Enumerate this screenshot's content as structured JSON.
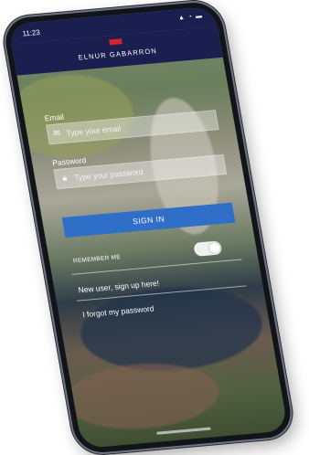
{
  "status_bar": {
    "time": "11:23",
    "icons": "▲ ◔ ▬"
  },
  "brand": {
    "name": "ELNUR GABARRON"
  },
  "login": {
    "email_label": "Email",
    "email_placeholder": "Type your email",
    "password_label": "Password",
    "password_placeholder": "Type your password",
    "sign_in_label": "SIGN IN",
    "remember_label": "REMEMBER ME",
    "remember_on": true
  },
  "links": {
    "signup": "New user, sign up here!",
    "forgot": "I forgot my password"
  },
  "colors": {
    "header": "#1b1f4f",
    "brand_mark": "#d4232a",
    "button": "#2f6fc7"
  },
  "icons": {
    "email": "mail-icon",
    "password": "lock-icon"
  }
}
